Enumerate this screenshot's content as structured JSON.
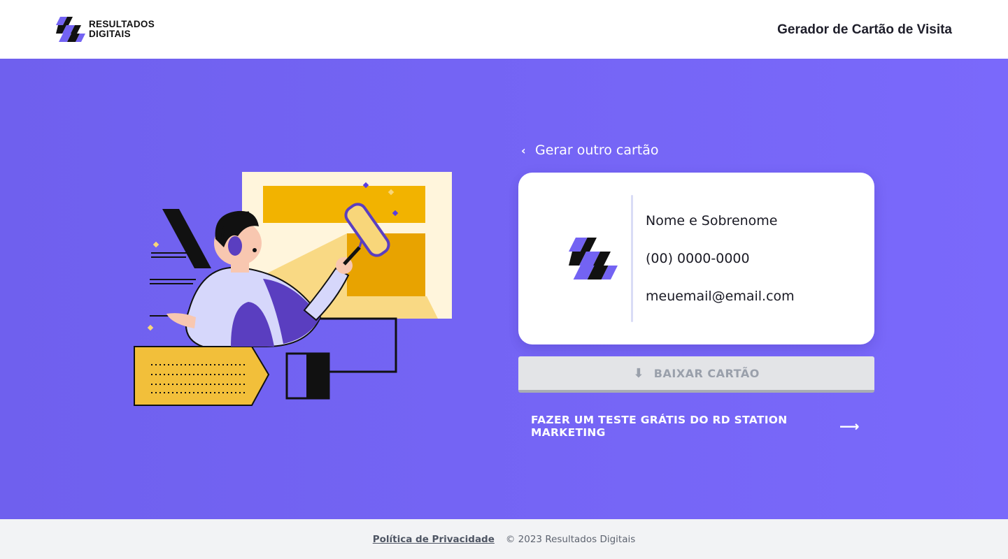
{
  "header": {
    "logo_line1": "RESULTADOS",
    "logo_line2": "DIGITAIS",
    "title": "Gerador de Cartão de Visita"
  },
  "hero": {
    "back_link": "Gerar outro cartão",
    "card": {
      "name": "Nome e Sobrenome",
      "phone": "(00) 0000-0000",
      "email": "meuemail@email.com"
    },
    "download_button": "BAIXAR CARTÃO",
    "trial_link": "FAZER UM TESTE GRÁTIS DO RD STATION MARKETING"
  },
  "footer": {
    "privacy_link": "Política de Privacidade",
    "copyright": "© 2023 Resultados Digitais"
  },
  "icons": {
    "back": "chevron-left-icon",
    "download": "download-icon",
    "trial": "arrow-right-icon"
  },
  "colors": {
    "brand_purple": "#7363f3",
    "accent_yellow": "#f2b300",
    "button_disabled": "#e3e4e7"
  }
}
